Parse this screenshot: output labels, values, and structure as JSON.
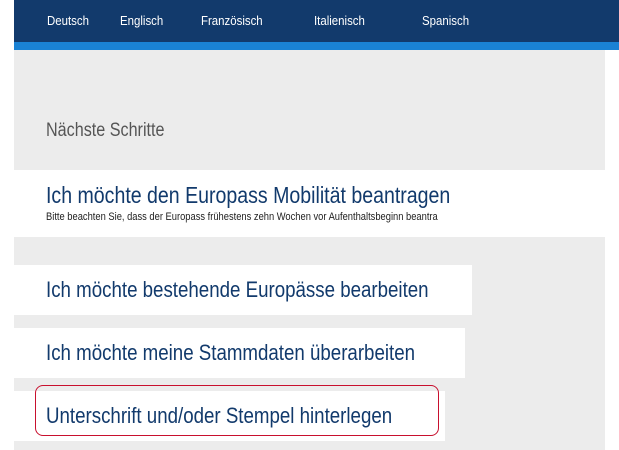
{
  "language_nav": {
    "items": [
      "Deutsch",
      "Englisch",
      "Französisch",
      "Italienisch",
      "Spanisch"
    ]
  },
  "next_steps": {
    "heading": "Nächste Schritte",
    "mobility": {
      "title": "Ich möchte den Europass Mobilität beantragen",
      "note": "Bitte beachten Sie, dass der Europass frühestens zehn Wochen vor Aufenthaltsbeginn beantra"
    },
    "edit_existing": "Ich möchte bestehende Europässe bearbeiten",
    "edit_master_data": "Ich möchte meine Stammdaten überarbeiten",
    "signature_stamp": "Unterschrift und/oder Stempel hinterlegen"
  },
  "colors": {
    "nav_background": "#123a6c",
    "nav_accent": "#1a82d4",
    "link": "#123a6c",
    "highlight_border": "#c8102e",
    "panel_background": "#ececec"
  }
}
